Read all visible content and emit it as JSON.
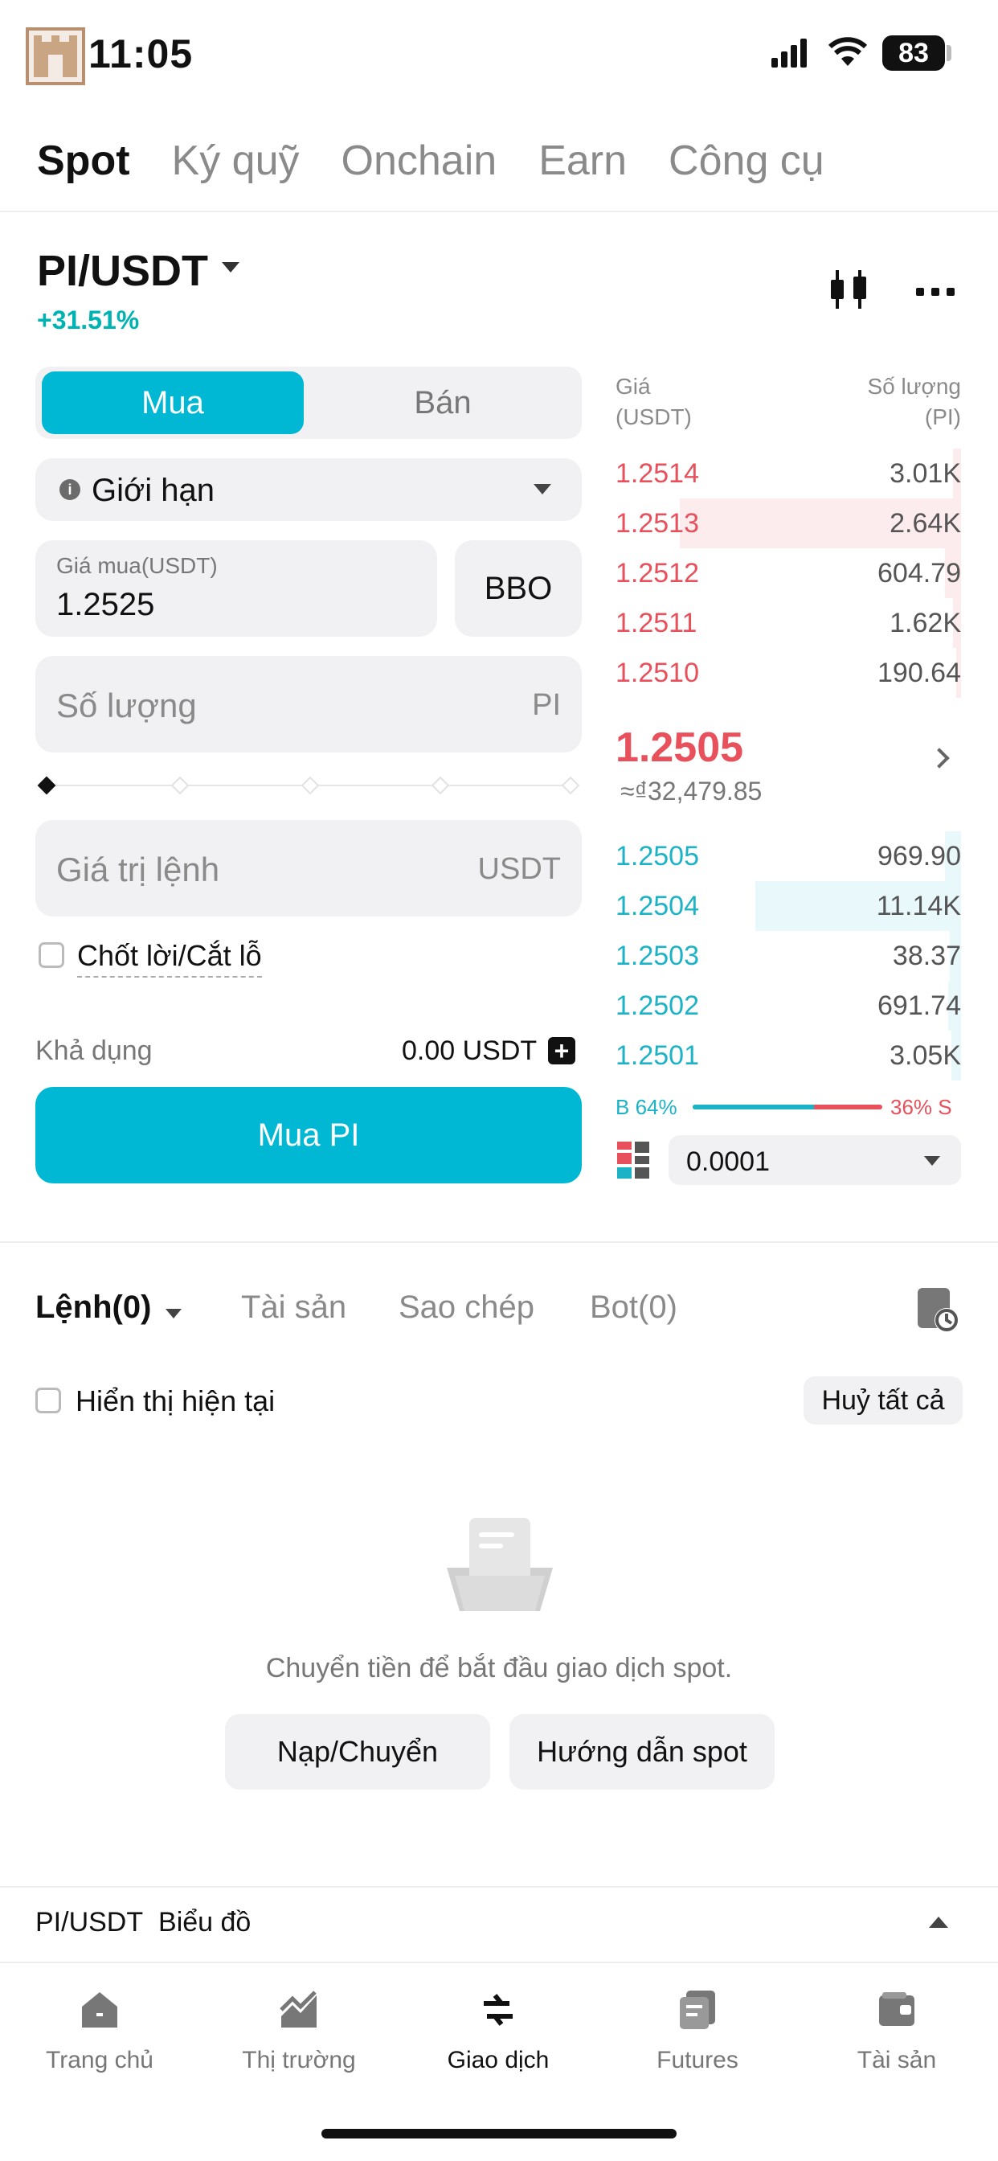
{
  "status": {
    "time": "11:05",
    "battery": "83"
  },
  "top_tabs": [
    "Spot",
    "Ký quỹ",
    "Onchain",
    "Earn",
    "Công cụ"
  ],
  "pair": {
    "name": "PI/USDT",
    "change": "+31.51%"
  },
  "trade": {
    "buy_label": "Mua",
    "sell_label": "Bán",
    "order_type": "Giới hạn",
    "price_caption": "Giá mua(USDT)",
    "price_value": "1.2525",
    "bbo_label": "BBO",
    "qty_placeholder": "Số lượng",
    "qty_unit": "PI",
    "total_placeholder": "Giá trị lệnh",
    "total_unit": "USDT",
    "tpsl_label": "Chốt lời/Cắt lỗ",
    "avail_label": "Khả dụng",
    "avail_value": "0.00 USDT",
    "buy_button": "Mua PI",
    "slider_level": 0
  },
  "orderbook": {
    "head_price": [
      "Giá",
      "(USDT)"
    ],
    "head_qty": [
      "Số lượng",
      "(PI)"
    ],
    "asks": [
      {
        "price": "1.2514",
        "qty": "3.01K"
      },
      {
        "price": "1.2513",
        "qty": "2.64K"
      },
      {
        "price": "1.2512",
        "qty": "604.79"
      },
      {
        "price": "1.2511",
        "qty": "1.62K"
      },
      {
        "price": "1.2510",
        "qty": "190.64"
      }
    ],
    "last_price": "1.2505",
    "last_fiat": "≈₫32,479.85",
    "bids": [
      {
        "price": "1.2505",
        "qty": "969.90"
      },
      {
        "price": "1.2504",
        "qty": "11.14K"
      },
      {
        "price": "1.2503",
        "qty": "38.37"
      },
      {
        "price": "1.2502",
        "qty": "691.74"
      },
      {
        "price": "1.2501",
        "qty": "3.05K"
      }
    ],
    "buy_ratio_label": "B 64%",
    "sell_ratio_label": "36% S",
    "buy_ratio": 0.64,
    "precision": "0.0001"
  },
  "orders": {
    "tabs": [
      "Lệnh(0)",
      "Tài sản",
      "Sao chép",
      "Bot(0)"
    ],
    "show_current": "Hiển thị hiện tại",
    "cancel_all": "Huỷ tất cả",
    "empty_text": "Chuyển tiền để bắt đầu giao dịch spot.",
    "deposit_button": "Nạp/Chuyển",
    "guide_button": "Hướng dẫn spot"
  },
  "chart_bar": {
    "pair": "PI/USDT",
    "label": "Biểu đồ"
  },
  "nav": [
    "Trang chủ",
    "Thị trường",
    "Giao dịch",
    "Futures",
    "Tài sản"
  ],
  "colors": {
    "accent": "#00b8d4",
    "ask": "#e8505b",
    "bid": "#1db3c6"
  },
  "icons": {
    "candle": "candlestick-icon",
    "more": "more-dots-icon",
    "history": "history-clock-icon",
    "empty": "empty-document-icon"
  }
}
